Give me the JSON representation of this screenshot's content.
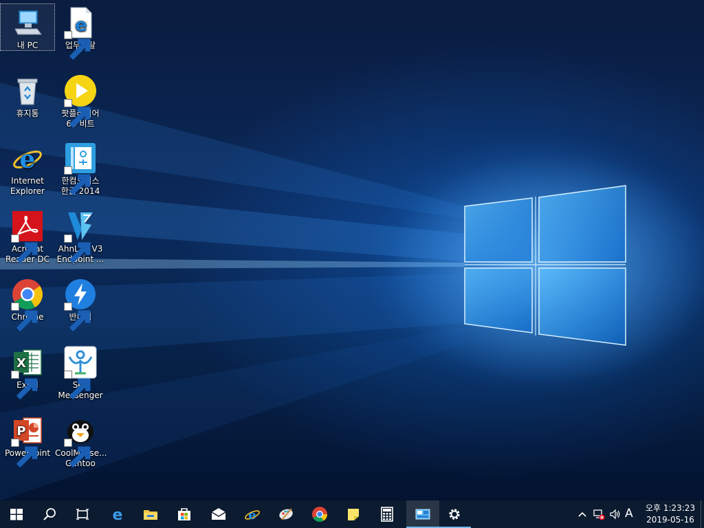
{
  "desktop": {
    "icons": [
      {
        "id": "my-pc",
        "label": "내 PC",
        "icon": "computer-icon",
        "shortcut": false,
        "selected": true
      },
      {
        "id": "recycle-bin",
        "label": "휴지통",
        "icon": "recycle-bin-icon",
        "shortcut": false
      },
      {
        "id": "internet-explorer",
        "label": "Internet Explorer",
        "icon": "internet-explorer-icon",
        "shortcut": false
      },
      {
        "id": "acrobat-reader",
        "label": "Acrobat Reader DC",
        "icon": "acrobat-icon",
        "shortcut": true
      },
      {
        "id": "chrome",
        "label": "Chrome",
        "icon": "chrome-icon",
        "shortcut": true
      },
      {
        "id": "excel",
        "label": "Excel",
        "icon": "excel-icon",
        "shortcut": true
      },
      {
        "id": "powerpoint",
        "label": "PowerPoint",
        "icon": "powerpoint-icon",
        "shortcut": true
      },
      {
        "id": "business-portal",
        "label": "업무포탈",
        "icon": "edge-document-icon",
        "shortcut": true
      },
      {
        "id": "potplayer",
        "label": "팟플레이어 64 비트",
        "icon": "potplayer-icon",
        "shortcut": true
      },
      {
        "id": "hancom-office",
        "label": "한컴오피스 한글 2014",
        "icon": "hangul-icon",
        "shortcut": true
      },
      {
        "id": "ahnlab-v3",
        "label": "AhnLab V3 Endpoint ...",
        "icon": "ahnlab-v3-icon",
        "shortcut": true
      },
      {
        "id": "bandizip",
        "label": "반디집",
        "icon": "bandizip-icon",
        "shortcut": true
      },
      {
        "id": "sen-messenger",
        "label": "Sen Messenger",
        "icon": "sen-messenger-icon",
        "shortcut": true
      },
      {
        "id": "coolmessenger",
        "label": "CoolMesse... Gentoo",
        "icon": "coolmessenger-icon",
        "shortcut": true
      }
    ]
  },
  "taskbar": {
    "buttons": [
      {
        "id": "start",
        "icon": "windows-start-icon",
        "state": "none"
      },
      {
        "id": "search",
        "icon": "search-icon",
        "state": "none"
      },
      {
        "id": "task-view",
        "icon": "task-view-icon",
        "state": "none"
      },
      {
        "id": "edge",
        "icon": "edge-icon",
        "state": "none"
      },
      {
        "id": "file-explorer",
        "icon": "file-explorer-icon",
        "state": "none"
      },
      {
        "id": "store",
        "icon": "store-icon",
        "state": "none"
      },
      {
        "id": "mail",
        "icon": "mail-icon",
        "state": "none"
      },
      {
        "id": "internet-explorer",
        "icon": "internet-explorer-icon",
        "state": "none"
      },
      {
        "id": "paint",
        "icon": "paint-icon",
        "state": "none"
      },
      {
        "id": "chrome",
        "icon": "chrome-icon",
        "state": "none"
      },
      {
        "id": "sticky-notes",
        "icon": "sticky-notes-icon",
        "state": "none"
      },
      {
        "id": "calculator",
        "icon": "calculator-icon",
        "state": "none"
      },
      {
        "id": "control-panel",
        "icon": "control-panel-icon",
        "state": "running-active"
      },
      {
        "id": "settings",
        "icon": "gear-icon",
        "state": "running"
      }
    ],
    "tray": {
      "overflow_icon": "chevron-up-icon",
      "network_icon": "network-disconnected-icon",
      "volume_icon": "volume-icon",
      "ime_label": "A",
      "time": "오후 1:23:23",
      "date": "2019-05-16"
    }
  },
  "colors": {
    "taskbar": "#0c1b2f",
    "accent": "#76b9ed",
    "wallpaper_glow": "#1a8cff"
  }
}
